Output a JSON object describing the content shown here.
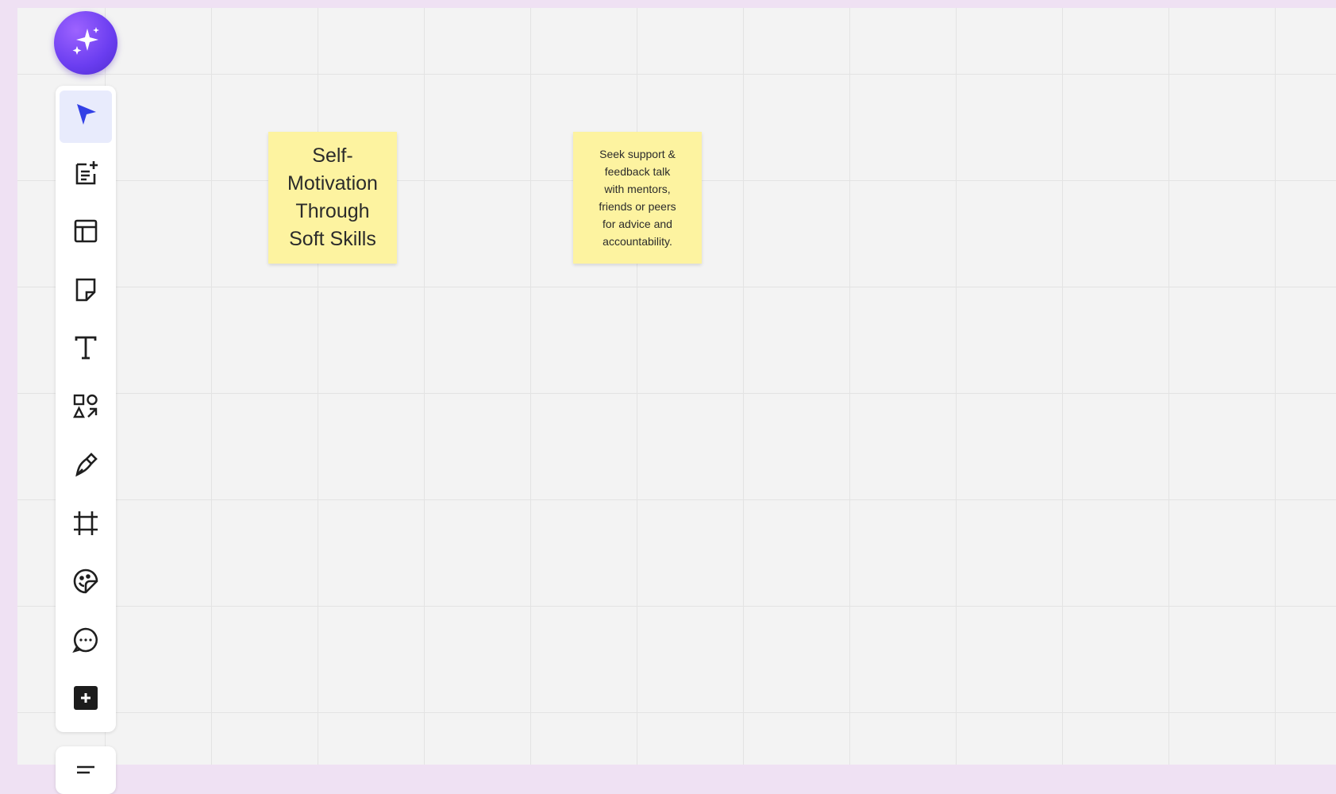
{
  "app": {
    "accent_color": "#5b3ee8",
    "canvas_color": "#f3f3f3"
  },
  "ai_button": {
    "icon": "sparkles-icon"
  },
  "toolbar": {
    "tools": [
      {
        "name": "select",
        "icon": "cursor-icon",
        "active": true
      },
      {
        "name": "templates-notes",
        "icon": "note-add-icon",
        "active": false
      },
      {
        "name": "layouts",
        "icon": "layout-icon",
        "active": false
      },
      {
        "name": "sticky-note",
        "icon": "sticky-note-icon",
        "active": false
      },
      {
        "name": "text",
        "icon": "text-icon",
        "active": false
      },
      {
        "name": "shapes",
        "icon": "shapes-icon",
        "active": false
      },
      {
        "name": "pen",
        "icon": "pen-icon",
        "active": false
      },
      {
        "name": "frame",
        "icon": "frame-icon",
        "active": false
      },
      {
        "name": "stickers",
        "icon": "sticker-icon",
        "active": false
      },
      {
        "name": "comment",
        "icon": "comment-icon",
        "active": false
      },
      {
        "name": "more",
        "icon": "plus-square-icon",
        "active": false
      }
    ],
    "secondary_icon": "list-icon"
  },
  "notes": [
    {
      "text": "Self-\nMotivation\nThrough\nSoft Skills",
      "color": "#fdf3a0"
    },
    {
      "text": "Seek support &\nfeedback talk\nwith  mentors,\nfriends or peers\nfor advice and\naccountability.",
      "color": "#fdf3a0"
    }
  ]
}
